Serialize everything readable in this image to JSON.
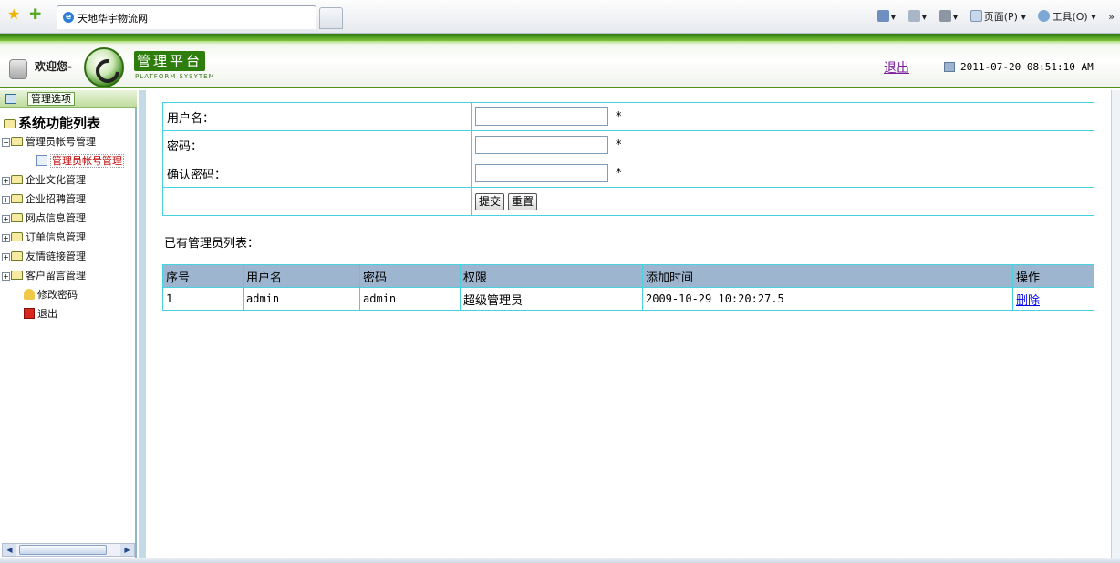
{
  "browser": {
    "tab_title": "天地华宇物流网",
    "page_menu": "页面(P)",
    "tools_menu": "工具(O)",
    "more": "»"
  },
  "header": {
    "welcome": "欢迎您-",
    "platform_title": "管理平台",
    "platform_subtitle": "PLATFORM SYSYTEM",
    "logout": "退出",
    "datetime": "2011-07-20 08:51:10 AM",
    "accent_color": "#2e7e0e"
  },
  "sidebar": {
    "header_label": "管理选项",
    "root": "系统功能列表",
    "items": [
      {
        "label": "管理员帐号管理",
        "expanded": true
      },
      {
        "label": "管理员帐号管理",
        "child": true,
        "selected": true
      },
      {
        "label": "企业文化管理"
      },
      {
        "label": "企业招聘管理"
      },
      {
        "label": "网点信息管理"
      },
      {
        "label": "订单信息管理"
      },
      {
        "label": "友情链接管理"
      },
      {
        "label": "客户留言管理"
      },
      {
        "label": "修改密码",
        "leaf": true
      },
      {
        "label": "退出",
        "leaf": true
      }
    ]
  },
  "form": {
    "username_label": "用户名：",
    "password_label": "密码：",
    "confirm_label": "确认密码：",
    "required_mark": "*",
    "username_value": "",
    "password_value": "",
    "confirm_value": "",
    "submit": "提交",
    "reset": "重置"
  },
  "list": {
    "title": "已有管理员列表：",
    "columns": [
      "序号",
      "用户名",
      "密码",
      "权限",
      "添加时间",
      "操作"
    ],
    "rows": [
      {
        "id": "1",
        "username": "admin",
        "password": "admin",
        "role": "超级管理员",
        "added": "2009-10-29 10:20:27.5",
        "action": "删除"
      }
    ]
  }
}
